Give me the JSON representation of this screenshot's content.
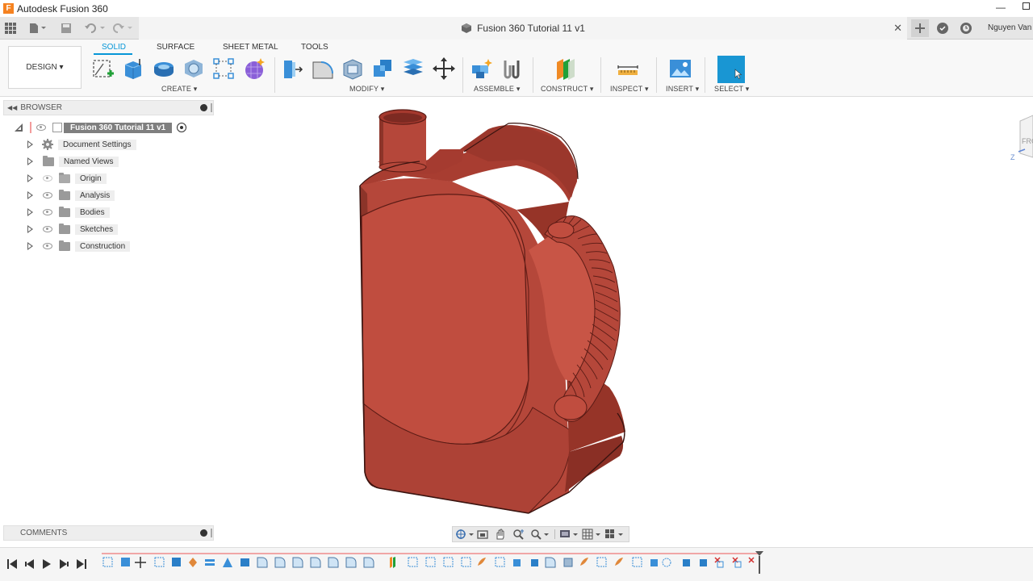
{
  "app": {
    "window_title": "Autodesk Fusion 360",
    "user": "Nguyen Van",
    "logo_letter": "F"
  },
  "document": {
    "title": "Fusion 360 Tutorial 11 v1"
  },
  "ribbon": {
    "workspace": "DESIGN ▾",
    "tabs": [
      "SOLID",
      "SURFACE",
      "SHEET METAL",
      "TOOLS"
    ],
    "active_tab": "SOLID",
    "groups": [
      "CREATE ▾",
      "MODIFY ▾",
      "ASSEMBLE ▾",
      "CONSTRUCT ▾",
      "INSPECT ▾",
      "INSERT ▾",
      "SELECT ▾"
    ]
  },
  "browser": {
    "header": "BROWSER",
    "root": "Fusion 360 Tutorial 11 v1",
    "items": [
      "Document Settings",
      "Named Views",
      "Origin",
      "Analysis",
      "Bodies",
      "Sketches",
      "Construction"
    ]
  },
  "comments": {
    "header": "COMMENTS"
  },
  "viewcube": {
    "face_label": "FRO",
    "axis_label": "Z"
  },
  "colors": {
    "accent": "#0696d7",
    "model_body": "#b5473a",
    "model_dark": "#7d2a22",
    "timeline_track": "#f0a6a6"
  },
  "icons": {
    "quick_access": [
      "grid-icon",
      "file-icon",
      "save-icon",
      "undo-icon",
      "redo-icon"
    ],
    "tab_right": [
      "new-tab-icon",
      "job-status-icon",
      "clock-icon"
    ],
    "timeline": [
      "go-to-start-icon",
      "step-back-icon",
      "play-icon",
      "step-forward-icon",
      "go-to-end-icon"
    ]
  }
}
